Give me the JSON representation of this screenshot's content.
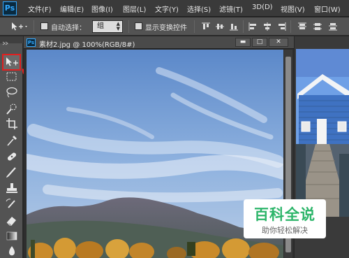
{
  "app": {
    "logo_text": "Ps"
  },
  "menu": {
    "items": [
      {
        "label": "文件(F)"
      },
      {
        "label": "编辑(E)"
      },
      {
        "label": "图像(I)"
      },
      {
        "label": "图层(L)"
      },
      {
        "label": "文字(Y)"
      },
      {
        "label": "选择(S)"
      },
      {
        "label": "滤镜(T)"
      },
      {
        "label": "3D(D)"
      },
      {
        "label": "视图(V)"
      },
      {
        "label": "窗口(W)"
      }
    ]
  },
  "options_bar": {
    "auto_select_label": "自动选择：",
    "auto_select_value": "组",
    "show_transform_label": "显示变换控件"
  },
  "document": {
    "icon_text": "Ps",
    "title": "素材2.jpg @ 100%(RGB/8#)",
    "minimize_label": "▬",
    "maximize_label": "□",
    "close_label": "✕"
  },
  "watermark": {
    "title": "百科全说",
    "subtitle": "助你轻松解决"
  },
  "colors": {
    "highlight_red": "#e02020",
    "ps_blue": "#31a8ff",
    "watermark_green": "#2db56a"
  },
  "icons": [
    "move-tool-icon",
    "marquee-tool-icon",
    "lasso-tool-icon",
    "quick-select-tool-icon",
    "crop-tool-icon",
    "eyedropper-tool-icon",
    "healing-brush-icon",
    "brush-tool-icon",
    "clone-stamp-icon",
    "history-brush-icon",
    "eraser-tool-icon",
    "gradient-tool-icon",
    "blur-tool-icon"
  ]
}
